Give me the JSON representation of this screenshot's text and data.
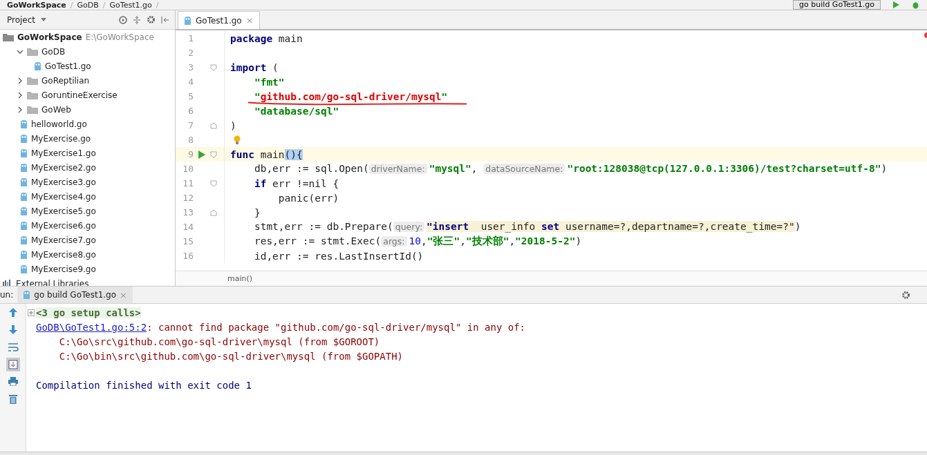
{
  "navbar": {
    "breadcrumbs": [
      {
        "label": "GoWorkSpace",
        "separator": "/"
      },
      {
        "label": "GoDB",
        "separator": "/"
      },
      {
        "label": "GoTest1.go",
        "separator": "/"
      }
    ],
    "run_config": "go build GoTest1.go"
  },
  "project": {
    "title": "Project",
    "tree": [
      {
        "label": "GoWorkSpace",
        "path": "E:\\GoWorkSpace",
        "kind": "root",
        "children": [
          {
            "label": "GoDB",
            "kind": "folder",
            "expanded": true,
            "children": [
              {
                "label": "GoTest1.go",
                "kind": "file"
              }
            ]
          },
          {
            "label": "GoReptilian",
            "kind": "folder",
            "expanded": false
          },
          {
            "label": "GoruntineExercise",
            "kind": "folder",
            "expanded": false
          },
          {
            "label": "GoWeb",
            "kind": "folder",
            "expanded": false
          },
          {
            "label": "helloworld.go",
            "kind": "file"
          },
          {
            "label": "MyExercise.go",
            "kind": "file"
          },
          {
            "label": "MyExercise1.go",
            "kind": "file"
          },
          {
            "label": "MyExercise2.go",
            "kind": "file"
          },
          {
            "label": "MyExercise3.go",
            "kind": "file"
          },
          {
            "label": "MyExercise4.go",
            "kind": "file"
          },
          {
            "label": "MyExercise5.go",
            "kind": "file"
          },
          {
            "label": "MyExercise6.go",
            "kind": "file"
          },
          {
            "label": "MyExercise7.go",
            "kind": "file"
          },
          {
            "label": "MyExercise8.go",
            "kind": "file"
          },
          {
            "label": "MyExercise9.go",
            "kind": "file"
          }
        ]
      },
      {
        "label": "External Libraries",
        "kind": "library"
      }
    ]
  },
  "editor": {
    "tab": {
      "label": "GoTest1.go",
      "close": "×"
    },
    "breadcrumb": "main()",
    "lines": [
      {
        "number": "1",
        "current": false,
        "run": false,
        "bulb": false,
        "fold_start": false,
        "fold_end": false,
        "tokens": [
          {
            "kind": "kw",
            "text": "package"
          },
          {
            "kind": "plain",
            "text": " main"
          }
        ]
      },
      {
        "number": "2",
        "current": false,
        "run": false,
        "bulb": false,
        "fold_start": false,
        "fold_end": false
      },
      {
        "number": "3",
        "current": false,
        "run": false,
        "bulb": false,
        "fold_start": true,
        "fold_end": false,
        "tokens": [
          {
            "kind": "kw",
            "text": "import"
          },
          {
            "kind": "plain",
            "text": " ("
          }
        ]
      },
      {
        "number": "4",
        "current": false,
        "run": false,
        "bulb": false,
        "fold_start": false,
        "fold_end": false,
        "tokens": [
          {
            "kind": "str",
            "text": "    \"fmt\""
          }
        ]
      },
      {
        "number": "5",
        "current": false,
        "run": false,
        "bulb": false,
        "fold_start": false,
        "fold_end": false,
        "tokens": [
          {
            "kind": "str",
            "text": "    \""
          },
          {
            "kind": "err",
            "text": "github.com/go-sql-driver/mysql"
          },
          {
            "kind": "str",
            "text": "\""
          }
        ]
      },
      {
        "number": "6",
        "current": false,
        "run": false,
        "bulb": false,
        "fold_start": false,
        "fold_end": false,
        "tokens": [
          {
            "kind": "str",
            "text": "    \"database/sql\""
          }
        ]
      },
      {
        "number": "7",
        "current": false,
        "run": false,
        "bulb": false,
        "fold_start": false,
        "fold_end": true,
        "tokens": [
          {
            "kind": "plain",
            "text": ")"
          }
        ]
      },
      {
        "number": "8",
        "current": false,
        "run": false,
        "bulb": true,
        "fold_start": false,
        "fold_end": false
      },
      {
        "number": "9",
        "current": true,
        "run": true,
        "bulb": false,
        "fold_start": true,
        "fold_end": false,
        "tokens": [
          {
            "kind": "kw",
            "text": "func"
          },
          {
            "kind": "plain",
            "text": " main"
          },
          {
            "kind": "sel",
            "text": "(){"
          }
        ]
      },
      {
        "number": "10",
        "current": false,
        "run": false,
        "bulb": false,
        "fold_start": false,
        "fold_end": false,
        "tokens": [
          {
            "kind": "plain",
            "text": "    db,err := sql.Open("
          },
          {
            "kind": "hint",
            "text": "driverName:"
          },
          {
            "kind": "str",
            "text": "\"mysql\""
          },
          {
            "kind": "plain",
            "text": ", "
          },
          {
            "kind": "hint",
            "text": "dataSourceName:"
          },
          {
            "kind": "str",
            "text": "\"root:128038@tcp(127.0.0.1:3306)/test?charset=utf-8\""
          },
          {
            "kind": "plain",
            "text": ")"
          }
        ]
      },
      {
        "number": "11",
        "current": false,
        "run": false,
        "bulb": false,
        "fold_start": true,
        "fold_end": false,
        "tokens": [
          {
            "kind": "kw",
            "text": "    if"
          },
          {
            "kind": "plain",
            "text": " err !=nil {"
          }
        ]
      },
      {
        "number": "12",
        "current": false,
        "run": false,
        "bulb": false,
        "fold_start": false,
        "fold_end": false,
        "tokens": [
          {
            "kind": "plain",
            "text": "        panic(err)"
          }
        ]
      },
      {
        "number": "13",
        "current": false,
        "run": false,
        "bulb": false,
        "fold_start": false,
        "fold_end": true,
        "tokens": [
          {
            "kind": "plain",
            "text": "    }"
          }
        ]
      },
      {
        "number": "14",
        "current": false,
        "run": false,
        "bulb": false,
        "fold_start": false,
        "fold_end": false,
        "tokens": [
          {
            "kind": "plain",
            "text": "    stmt,err := db.Prepare("
          },
          {
            "kind": "hint",
            "text": "query:"
          },
          {
            "kind": "sqlkw",
            "text": "\"insert"
          },
          {
            "kind": "sql",
            "text": "  user_info "
          },
          {
            "kind": "sqlkw",
            "text": "set"
          },
          {
            "kind": "sql",
            "text": " username=?,departname=?,create_time=?\""
          },
          {
            "kind": "plain",
            "text": ")"
          }
        ]
      },
      {
        "number": "15",
        "current": false,
        "run": false,
        "bulb": false,
        "fold_start": false,
        "fold_end": false,
        "tokens": [
          {
            "kind": "plain",
            "text": "    res,err := stmt.Exec("
          },
          {
            "kind": "hint",
            "text": "args:"
          },
          {
            "kind": "num",
            "text": "10"
          },
          {
            "kind": "plain",
            "text": ","
          },
          {
            "kind": "str",
            "text": "\"张三\""
          },
          {
            "kind": "plain",
            "text": ","
          },
          {
            "kind": "str",
            "text": "\"技术部\""
          },
          {
            "kind": "plain",
            "text": ","
          },
          {
            "kind": "str",
            "text": "\"2018-5-2\""
          },
          {
            "kind": "plain",
            "text": ")"
          }
        ]
      },
      {
        "number": "16",
        "current": false,
        "run": false,
        "bulb": false,
        "fold_start": false,
        "fold_end": false,
        "tokens": [
          {
            "kind": "plain",
            "text": "    id,err := res.LastInsertId()"
          }
        ]
      }
    ]
  },
  "run_panel": {
    "label": "un:",
    "tab": {
      "label": "go build GoTest1.go",
      "close": "×"
    },
    "output": [
      {
        "kind": "setup",
        "text": "<3 go setup calls>"
      },
      {
        "kind": "error",
        "link": "GoDB\\GoTest1.go:5:2",
        "text": ": cannot find package \"github.com/go-sql-driver/mysql\" in any of:"
      },
      {
        "kind": "path",
        "text": "    C:\\Go\\src\\github.com\\go-sql-driver\\mysql (from $GOROOT)"
      },
      {
        "kind": "path",
        "text": "    C:\\Go\\bin\\src\\github.com\\go-sql-driver\\mysql (from $GOPATH)"
      },
      {
        "kind": "blank"
      },
      {
        "kind": "info",
        "text": "Compilation finished with exit code 1"
      }
    ]
  }
}
